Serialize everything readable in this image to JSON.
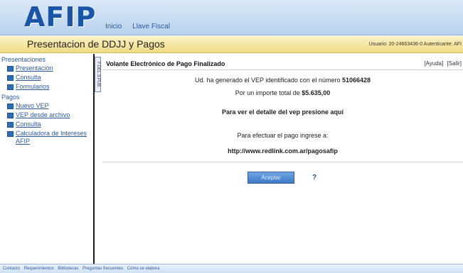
{
  "header": {
    "logo": "AFIP",
    "nav": [
      "Inicio",
      "Llave Fiscal"
    ]
  },
  "subheader": {
    "title": "Presentacion de DDJJ y Pagos",
    "user_info": "Usuario: 20-24663436-0 Autenticante: AFI"
  },
  "sidebar": {
    "sections": [
      {
        "title": "Presentaciones",
        "items": [
          "Presentación",
          "Consulta",
          "Formularios"
        ]
      },
      {
        "title": "Pagos",
        "items": [
          "Nuevo VEP",
          "VEP desde archivo",
          "Consulta",
          "Calculadora de Intereses AFIP"
        ]
      }
    ]
  },
  "tab_label": "F.DEL 3.PUB.",
  "main": {
    "title": "Volante Electrónico de Pago Finalizado",
    "help_links": [
      "[Ayuda]",
      "[Salir]"
    ],
    "vep_text": "Ud. ha generado el VEP identificado con el número",
    "vep_number": "51066428",
    "amount_text": "Por un importe total de",
    "amount": "$5.635,00",
    "detail_text": "Para ver el detalle del vep presione aquí",
    "pay_text": "Para efectuar el pago ingrese a:",
    "pay_url": "http://www.redlink.com.ar/pagosafip",
    "accept_label": "Aceptar",
    "help_icon": "?"
  },
  "footer": {
    "links": [
      "Contacto",
      "Requerimientos",
      "Bibliotecas",
      "Preguntas frecuentes",
      "Cómo se elabora"
    ]
  }
}
